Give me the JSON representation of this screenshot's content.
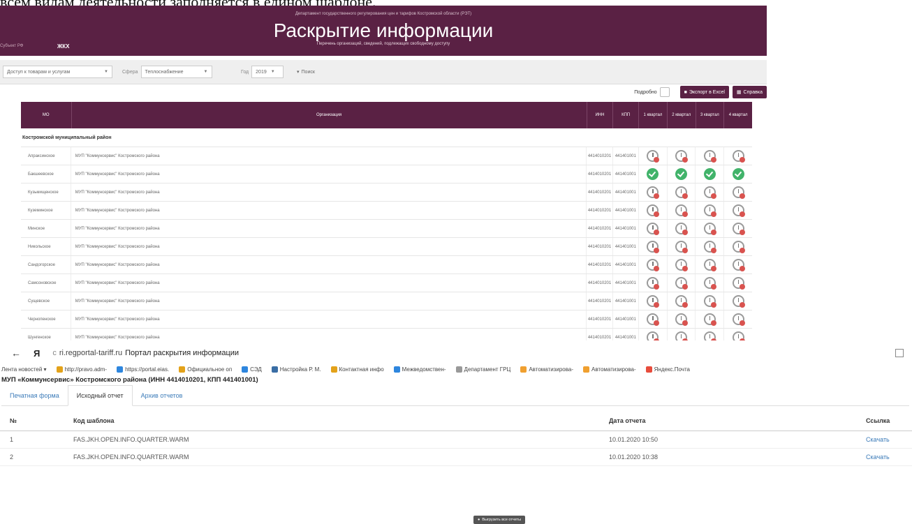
{
  "caption": "всем видам деятельности заполняется в едином шаблоне.",
  "portal": {
    "department": "Департамент государственного регулирования цен и тарифов Костромской области (РЭТ)",
    "title": "Раскрытие информации",
    "subtitle": "Перечень организаций, сведений, подлежащих свободному доступу",
    "left_label": "Субъект РФ",
    "left_value": "ЖКХ"
  },
  "filters": {
    "type_value": "Доступ к товарам и услугам",
    "sphere_label": "Сфера",
    "sphere_value": "Теплоснабжение",
    "year_label": "Год",
    "year_value": "2019",
    "search_label": "Поиск"
  },
  "toolbar": {
    "detail_label": "Подробно",
    "excel_label": "Экспорт в Excel",
    "help_label": "Справка"
  },
  "monitor_table": {
    "headers": {
      "mo": "МО",
      "org": "Организация",
      "inn": "ИНН",
      "kpp": "КПП",
      "q1": "1 квартал",
      "q2": "2 квартал",
      "q3": "3 квартал",
      "q4": "4 квартал"
    },
    "group": "Костромской муниципальный район",
    "rows": [
      {
        "mo": "Апраксинское",
        "org": "МУП \"Коммунсервис\" Костромского района",
        "inn": "4414010201",
        "kpp": "441401001",
        "status": [
          "clock",
          "clock",
          "clock",
          "clock"
        ]
      },
      {
        "mo": "Бакшеевское",
        "org": "МУП \"Коммунсервис\" Костромского района",
        "inn": "4414010201",
        "kpp": "441401001",
        "status": [
          "ok",
          "ok",
          "ok",
          "ok"
        ]
      },
      {
        "mo": "Кузьмищенское",
        "org": "МУП \"Коммунсервис\" Костромского района",
        "inn": "4414010201",
        "kpp": "441401001",
        "status": [
          "clock",
          "clock",
          "clock",
          "clock"
        ]
      },
      {
        "mo": "Куземинское",
        "org": "МУП \"Коммунсервис\" Костромского района",
        "inn": "4414010201",
        "kpp": "441401001",
        "status": [
          "clock",
          "clock",
          "clock",
          "clock"
        ]
      },
      {
        "mo": "Минское",
        "org": "МУП \"Коммунсервис\" Костромского района",
        "inn": "4414010201",
        "kpp": "441401001",
        "status": [
          "clock",
          "clock",
          "clock",
          "clock"
        ]
      },
      {
        "mo": "Никольское",
        "org": "МУП \"Коммунсервис\" Костромского района",
        "inn": "4414010201",
        "kpp": "441401001",
        "status": [
          "clock",
          "clock",
          "clock",
          "clock"
        ]
      },
      {
        "mo": "Сандогорское",
        "org": "МУП \"Коммунсервис\" Костромского района",
        "inn": "4414010201",
        "kpp": "441401001",
        "status": [
          "clock",
          "clock",
          "clock",
          "clock"
        ]
      },
      {
        "mo": "Самсоновское",
        "org": "МУП \"Коммунсервис\" Костромского района",
        "inn": "4414010201",
        "kpp": "441401001",
        "status": [
          "clock",
          "clock",
          "clock",
          "clock"
        ]
      },
      {
        "mo": "Сущевское",
        "org": "МУП \"Коммунсервис\" Костромского района",
        "inn": "4414010201",
        "kpp": "441401001",
        "status": [
          "clock",
          "clock",
          "clock",
          "clock"
        ]
      },
      {
        "mo": "Чернопенское",
        "org": "МУП \"Коммунсервис\" Костромского района",
        "inn": "4414010201",
        "kpp": "441401001",
        "status": [
          "clock",
          "clock",
          "clock",
          "clock"
        ]
      },
      {
        "mo": "Шунгенское",
        "org": "МУП \"Коммунсервис\" Костромского района",
        "inn": "4414010201",
        "kpp": "441401001",
        "status": [
          "clock",
          "clock",
          "clock",
          "clock"
        ]
      }
    ]
  },
  "browser": {
    "back_icon": "arrow-left-icon",
    "yandex_label": "Я",
    "url": "ri.regportal-tariff.ru",
    "page_title": "Портал раскрытия информации",
    "bookmarks": [
      {
        "label": "Лента новостей ▾",
        "color": ""
      },
      {
        "label": "http://pravo.adm-",
        "color": "#e3a21a"
      },
      {
        "label": "https://portal.eias.",
        "color": "#2e86de"
      },
      {
        "label": "Официальное оп",
        "color": "#e3a21a"
      },
      {
        "label": "СЭД",
        "color": "#2e86de"
      },
      {
        "label": "Настройка Р. М.",
        "color": "#3a6ea5"
      },
      {
        "label": "Контактная инфо",
        "color": "#e3a21a"
      },
      {
        "label": "Межведомствен-",
        "color": "#2e86de"
      },
      {
        "label": "Департамент ГРЦ",
        "color": "#999999"
      },
      {
        "label": "Автоматизирова-",
        "color": "#f0a030"
      },
      {
        "label": "Автоматизирова-",
        "color": "#f0a030"
      },
      {
        "label": "Яндекс.Почта",
        "color": "#e74c3c"
      }
    ]
  },
  "report": {
    "org_title": "МУП «Коммунсервис» Костромского района (ИНН 4414010201, КПП 441401001)",
    "tabs": [
      "Печатная форма",
      "Исходный отчет",
      "Архив отчетов"
    ],
    "active_tab": 1,
    "headers": {
      "num": "№",
      "code": "Код шаблона",
      "date": "Дата отчета",
      "link": "Ссылка"
    },
    "rows": [
      {
        "num": "1",
        "code": "FAS.JKH.OPEN.INFO.QUARTER.WARM",
        "date": "10.01.2020 10:50",
        "link": "Скачать"
      },
      {
        "num": "2",
        "code": "FAS.JKH.OPEN.INFO.QUARTER.WARM",
        "date": "10.01.2020 10:38",
        "link": "Скачать"
      }
    ],
    "export_all_label": "Выгрузить все отчеты"
  },
  "colors": {
    "brand": "#5a2144",
    "ok": "#41b36a",
    "pending": "#d9534f",
    "link": "#3a7ab8"
  }
}
